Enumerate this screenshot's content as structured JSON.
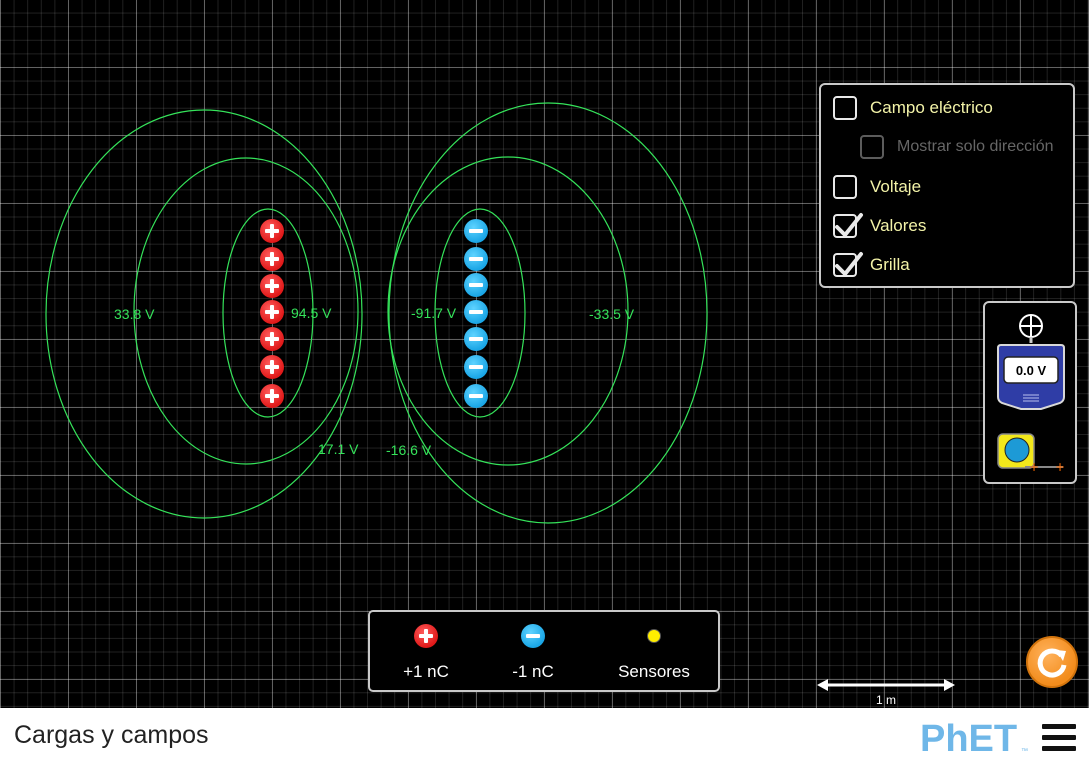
{
  "navbar": {
    "title": "Cargas y campos",
    "logo": "PhET",
    "menu_icon": "hamburger-menu-icon"
  },
  "controls": {
    "electric_field": {
      "label": "Campo eléctrico",
      "checked": false
    },
    "direction_only": {
      "label": "Mostrar solo dirección",
      "checked": false,
      "enabled": false
    },
    "voltage": {
      "label": "Voltaje",
      "checked": false
    },
    "values": {
      "label": "Valores",
      "checked": true
    },
    "grid": {
      "label": "Grilla",
      "checked": true
    }
  },
  "equipotential_labels": [
    "33.8 V",
    "94.5 V",
    "-91.7 V",
    "-33.5 V",
    "17.1 V",
    "-16.6 V"
  ],
  "voltmeter": {
    "reading": "0.0 V"
  },
  "tray": {
    "positive": "+1 nC",
    "negative": "-1 nC",
    "sensors": "Sensores"
  },
  "scale": {
    "label": "1 m"
  },
  "colors": {
    "equipotential": "#35e35a",
    "positive_charge": "#e01919",
    "negative_charge": "#1aa6e6",
    "label_text": "#f3f3a8",
    "reset": "#f28c1c"
  }
}
